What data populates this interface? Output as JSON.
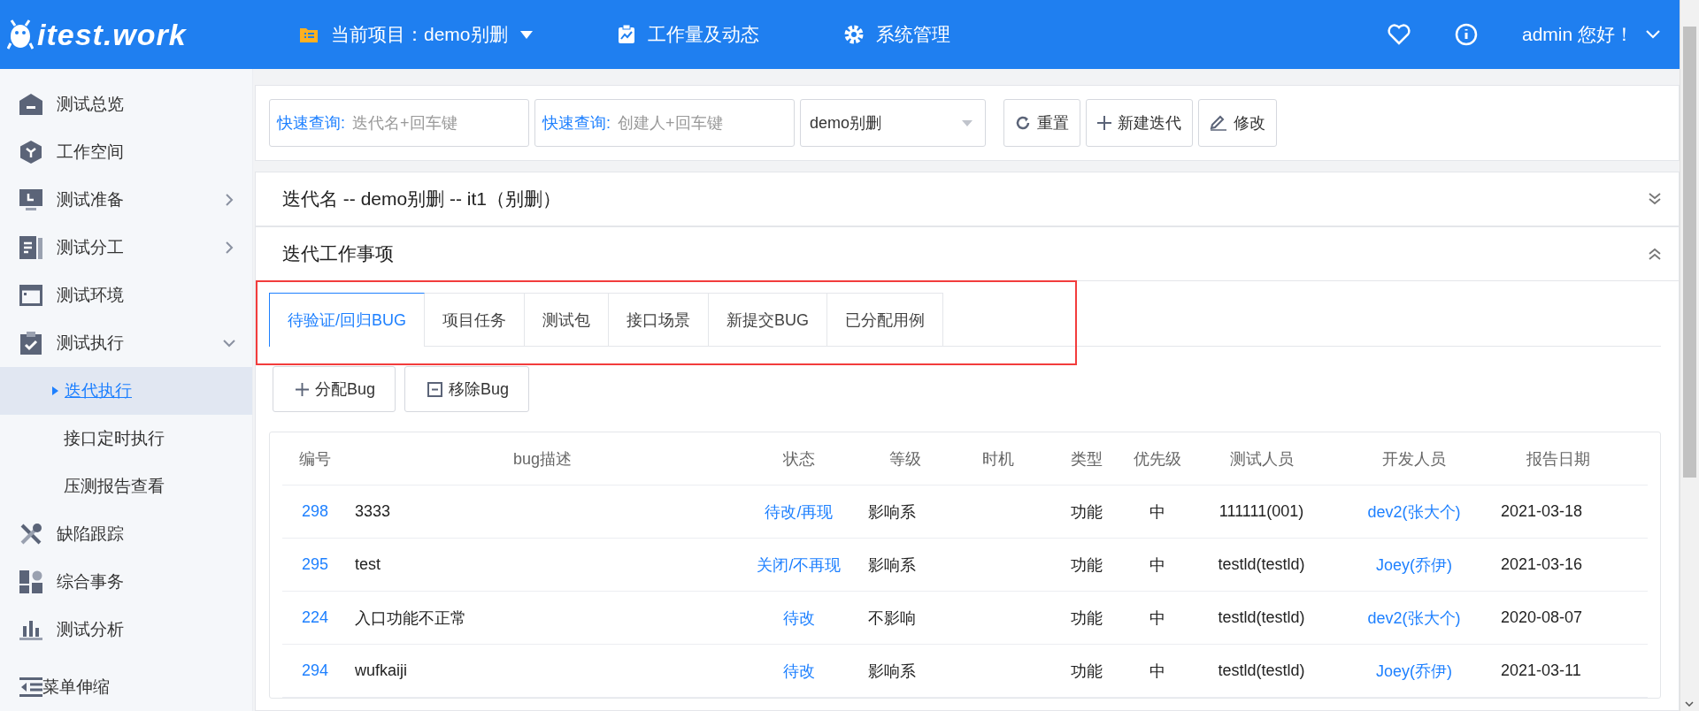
{
  "header": {
    "logo": "itest.work",
    "project": "当前项目：demo别删",
    "nav": [
      "工作量及动态",
      "系统管理"
    ],
    "user": "admin 您好！"
  },
  "sidebar": {
    "items": [
      {
        "label": "测试总览"
      },
      {
        "label": "工作空间"
      },
      {
        "label": "测试准备",
        "expanded": false
      },
      {
        "label": "测试分工",
        "expanded": false
      },
      {
        "label": "测试环境"
      },
      {
        "label": "测试执行",
        "expanded": true,
        "children": [
          {
            "label": "迭代执行",
            "selected": true
          },
          {
            "label": "接口定时执行",
            "selected": false
          },
          {
            "label": "压测报告查看",
            "selected": false
          }
        ]
      },
      {
        "label": "缺陷跟踪"
      },
      {
        "label": "综合事务"
      },
      {
        "label": "测试分析"
      }
    ],
    "footer": "菜单伸缩"
  },
  "toolbar": {
    "fields": [
      {
        "label": "快速查询:",
        "placeholder": "迭代名+回车键"
      },
      {
        "label": "快速查询:",
        "placeholder": "创建人+回车键"
      }
    ],
    "select": "demo别删",
    "buttons": [
      "重置",
      "新建迭代",
      "修改"
    ]
  },
  "panels": [
    {
      "title": "迭代名 -- demo别删 -- it1（别删）",
      "expanded": false
    },
    {
      "title": "迭代工作事项",
      "expanded": true
    }
  ],
  "tabs": [
    {
      "label": "待验证/回归BUG",
      "selected": true
    },
    {
      "label": "项目任务",
      "selected": false
    },
    {
      "label": "测试包",
      "selected": false
    },
    {
      "label": "接口场景",
      "selected": false
    },
    {
      "label": "新提交BUG",
      "selected": false
    },
    {
      "label": "已分配用例",
      "selected": false
    }
  ],
  "actions": [
    "分配Bug",
    "移除Bug"
  ],
  "table": {
    "columns": [
      "编号",
      "bug描述",
      "状态",
      "等级",
      "时机",
      "类型",
      "优先级",
      "测试人员",
      "开发人员",
      "报告日期"
    ],
    "rows": [
      [
        "298",
        "3333",
        "待改/再现",
        "影响系",
        "",
        "功能",
        "中",
        "111111(001)",
        "dev2(张大个)",
        "2021-03-18"
      ],
      [
        "295",
        "test",
        "关闭/不再现",
        "影响系",
        "",
        "功能",
        "中",
        "testld(testld)",
        "Joey(乔伊)",
        "2021-03-16"
      ],
      [
        "224",
        "入口功能不正常",
        "待改",
        "不影响",
        "",
        "功能",
        "中",
        "testld(testld)",
        "dev2(张大个)",
        "2020-08-07"
      ],
      [
        "294",
        "wufkaiji",
        "待改",
        "影响系",
        "",
        "功能",
        "中",
        "testld(testld)",
        "Joey(乔伊)",
        "2021-03-11"
      ]
    ]
  }
}
